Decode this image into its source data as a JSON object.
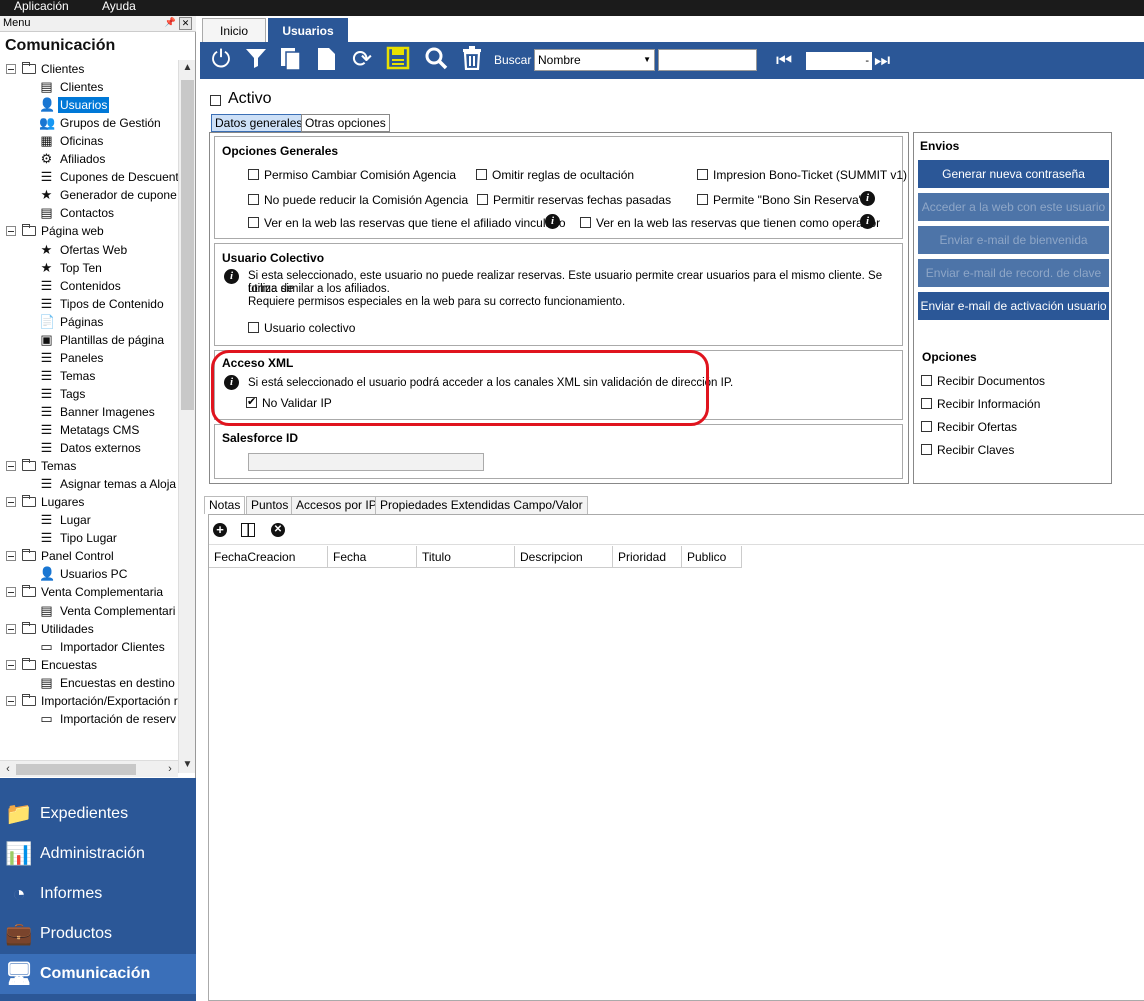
{
  "menubar": {
    "items": [
      "Aplicación",
      "Ayuda"
    ]
  },
  "left": {
    "header": "Menu",
    "module_title": "Comunicación",
    "tree": [
      {
        "type": "group",
        "label": "Clientes"
      },
      {
        "type": "leaf",
        "label": "Clientes",
        "icon": "form-icon"
      },
      {
        "type": "leaf",
        "label": "Usuarios",
        "icon": "user-icon",
        "selected": true
      },
      {
        "type": "leaf",
        "label": "Grupos de Gestión",
        "icon": "group-icon"
      },
      {
        "type": "leaf",
        "label": "Oficinas",
        "icon": "building-icon"
      },
      {
        "type": "leaf",
        "label": "Afiliados",
        "icon": "network-icon"
      },
      {
        "type": "leaf",
        "label": "Cupones de Descuent",
        "icon": "list-icon"
      },
      {
        "type": "leaf",
        "label": "Generador de cupone",
        "icon": "star-icon"
      },
      {
        "type": "leaf",
        "label": "Contactos",
        "icon": "form-icon"
      },
      {
        "type": "group",
        "label": "Página web"
      },
      {
        "type": "leaf",
        "label": "Ofertas Web",
        "icon": "star-icon"
      },
      {
        "type": "leaf",
        "label": "Top Ten",
        "icon": "star-icon"
      },
      {
        "type": "leaf",
        "label": "Contenidos",
        "icon": "list-icon"
      },
      {
        "type": "leaf",
        "label": "Tipos de Contenido",
        "icon": "list-icon"
      },
      {
        "type": "leaf",
        "label": "Páginas",
        "icon": "page-icon"
      },
      {
        "type": "leaf",
        "label": "Plantillas de página",
        "icon": "template-icon"
      },
      {
        "type": "leaf",
        "label": "Paneles",
        "icon": "list-icon"
      },
      {
        "type": "leaf",
        "label": "Temas",
        "icon": "list-icon"
      },
      {
        "type": "leaf",
        "label": "Tags",
        "icon": "list-icon"
      },
      {
        "type": "leaf",
        "label": "Banner Imagenes",
        "icon": "list-icon"
      },
      {
        "type": "leaf",
        "label": "Metatags CMS",
        "icon": "list-icon"
      },
      {
        "type": "leaf",
        "label": "Datos externos",
        "icon": "list-icon"
      },
      {
        "type": "group",
        "label": "Temas"
      },
      {
        "type": "leaf",
        "label": "Asignar temas a Aloja",
        "icon": "list-icon"
      },
      {
        "type": "group",
        "label": "Lugares"
      },
      {
        "type": "leaf",
        "label": "Lugar",
        "icon": "list-icon"
      },
      {
        "type": "leaf",
        "label": "Tipo Lugar",
        "icon": "list-icon"
      },
      {
        "type": "group",
        "label": "Panel Control"
      },
      {
        "type": "leaf",
        "label": "Usuarios PC",
        "icon": "user-icon"
      },
      {
        "type": "group",
        "label": "Venta Complementaria"
      },
      {
        "type": "leaf",
        "label": "Venta Complementari",
        "icon": "form-icon"
      },
      {
        "type": "group",
        "label": "Utilidades"
      },
      {
        "type": "leaf",
        "label": "Importador Clientes",
        "icon": "card-icon"
      },
      {
        "type": "group",
        "label": "Encuestas"
      },
      {
        "type": "leaf",
        "label": "Encuestas en destino",
        "icon": "form-icon"
      },
      {
        "type": "group",
        "label": "Importación/Exportación r"
      },
      {
        "type": "leaf",
        "label": "Importación de reserv",
        "icon": "card-icon"
      }
    ],
    "modules": [
      {
        "label": "Expedientes",
        "icon": "folder-icon"
      },
      {
        "label": "Administración",
        "icon": "bar-chart-icon"
      },
      {
        "label": "Informes",
        "icon": "pie-chart-icon"
      },
      {
        "label": "Productos",
        "icon": "suitcase-icon"
      },
      {
        "label": "Comunicación",
        "icon": "monitor-icon",
        "active": true
      }
    ]
  },
  "tabs": [
    "Inicio",
    "Usuarios"
  ],
  "toolbar": {
    "buscar_label": "Buscar",
    "search_field": "Nombre",
    "search_value": "",
    "page_value": "-"
  },
  "form": {
    "activo_label": "Activo",
    "subtabs": [
      "Datos generales",
      "Otras opciones"
    ],
    "opciones_generales": {
      "title": "Opciones Generales",
      "options": [
        "Permiso Cambiar Comisión Agencia",
        "Omitir reglas de ocultación",
        "Impresion Bono-Ticket (SUMMIT v1)",
        "No puede reducir la Comisión Agencia",
        "Permitir reservas fechas pasadas",
        "Permite \"Bono Sin Reserva\"",
        "Ver en la web las reservas que tiene el afiliado vinculado",
        "Ver en la web las reservas que tienen como operador"
      ]
    },
    "usuario_colectivo": {
      "title": "Usuario Colectivo",
      "info_line1": "Si esta seleccionado, este usuario no puede realizar reservas. Este usuario permite crear usuarios para el mismo cliente. Se utiliza de",
      "info_line2": "forma similar a los afiliados.",
      "info_line3": "Requiere permisos especiales en la web para su correcto funcionamiento.",
      "checkbox": "Usuario colectivo"
    },
    "acceso_xml": {
      "title": "Acceso XML",
      "info": "Si está seleccionado el usuario podrá acceder a los canales XML sin validación de dirección IP.",
      "checkbox": "No Validar IP",
      "checked": true
    },
    "salesforce": {
      "title": "Salesforce ID",
      "value": ""
    },
    "envios": {
      "title": "Envios",
      "buttons": [
        {
          "label": "Generar nueva contraseña",
          "enabled": true
        },
        {
          "label": "Acceder a la web con este usuario",
          "enabled": false
        },
        {
          "label": "Enviar e-mail de bienvenida",
          "enabled": false
        },
        {
          "label": "Enviar e-mail de record. de clave",
          "enabled": false
        },
        {
          "label": "Enviar e-mail de activación usuario",
          "enabled": true
        }
      ],
      "opciones_title": "Opciones",
      "opciones": [
        "Recibir Documentos",
        "Recibir Información",
        "Recibir Ofertas",
        "Recibir Claves"
      ]
    }
  },
  "bottom": {
    "tabs": [
      "Notas",
      "Puntos",
      "Accesos por IP",
      "Propiedades Extendidas Campo/Valor"
    ],
    "columns": [
      "FechaCreacion",
      "Fecha",
      "Titulo",
      "Descripcion",
      "Prioridad",
      "Publico"
    ]
  },
  "colors": {
    "accent": "#2b5797",
    "highlight": "#e0141e"
  }
}
